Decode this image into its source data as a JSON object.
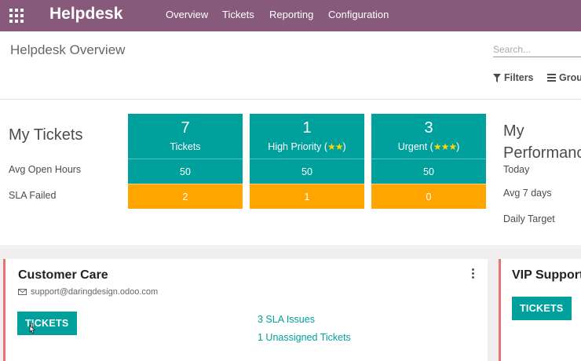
{
  "navbar": {
    "brand": "Helpdesk",
    "menu": [
      "Overview",
      "Tickets",
      "Reporting",
      "Configuration"
    ]
  },
  "control_panel": {
    "title": "Helpdesk Overview",
    "search_placeholder": "Search...",
    "filters_label": "Filters",
    "group_by_label": "Grou"
  },
  "my_tickets": {
    "title": "My Tickets",
    "row_labels": [
      "Avg Open Hours",
      "SLA Failed"
    ],
    "columns": [
      {
        "count": "7",
        "label": "Tickets",
        "stars": "",
        "avg_open_hours": "50",
        "sla_failed": "2"
      },
      {
        "count": "1",
        "label": "High Priority (",
        "stars": "★★",
        "label_end": ")",
        "avg_open_hours": "50",
        "sla_failed": "1"
      },
      {
        "count": "3",
        "label": "Urgent (",
        "stars": "★★★",
        "label_end": ")",
        "avg_open_hours": "50",
        "sla_failed": "0"
      }
    ]
  },
  "performance": {
    "title_line1": "My",
    "title_line2": "Performanc",
    "labels": [
      "Today",
      "Avg 7 days",
      "Daily Target"
    ]
  },
  "teams": [
    {
      "name": "Customer Care",
      "email": "support@daringdesign.odoo.com",
      "button": "TICKETS",
      "links": [
        "3 SLA Issues",
        "1 Unassigned Tickets"
      ]
    },
    {
      "name": "VIP Support",
      "button": "TICKETS"
    }
  ],
  "colors": {
    "navbar": "#875a7b",
    "teal": "#00a09d",
    "orange": "#ffa500",
    "star": "#ffd700",
    "card_accent": "#e8746d"
  },
  "icons": [
    "apps-grid-icon",
    "filter-icon",
    "group-by-icon",
    "envelope-icon",
    "kebab-menu-icon",
    "mouse-cursor-icon"
  ]
}
